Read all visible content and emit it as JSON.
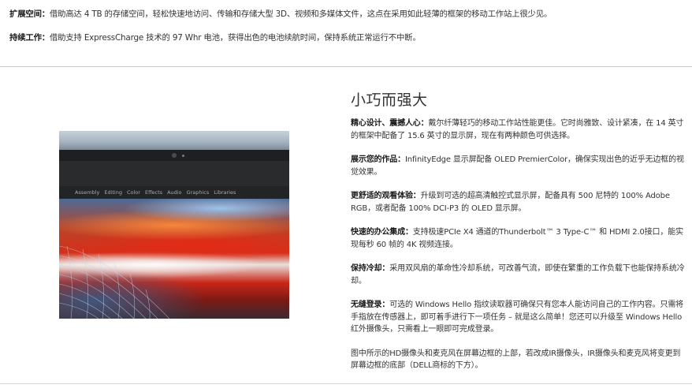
{
  "top": {
    "items": [
      {
        "label": "扩展空间：",
        "text": "借助高达 4 TB 的存储空间，轻松快速地访问、传输和存储大型 3D、视频和多媒体文件，这点在采用如此轻薄的框架的移动工作站上很少见。"
      },
      {
        "label": "持续工作：",
        "text": "借助支持 ExpressCharge 技术的 97 Whr 电池，获得出色的电池续航时间，保持系统正常运行不中断。"
      }
    ]
  },
  "image": {
    "menu_items": [
      "Assembly",
      "Editing",
      "Color",
      "Effects",
      "Audio",
      "Graphics",
      "Libraries"
    ]
  },
  "section": {
    "title": "小巧而强大",
    "items": [
      {
        "label": "精心设计、震撼人心：",
        "text": "戴尔纤薄轻巧的移动工作站性能更佳。它时尚雅致、设计紧凑，在 14 英寸的框架中配备了 15.6 英寸的显示屏，现在有两种颜色可供选择。"
      },
      {
        "label": "展示您的作品：",
        "text": "InfinityEdge 显示屏配备 OLED PremierColor，确保实现出色的近乎无边框的视觉效果。"
      },
      {
        "label": "更舒适的观看体验：",
        "text": "升级到可选的超高清触控式显示屏，配备具有 500 尼特的 100% Adobe RGB，或者配备 100% DCI-P3 的 OLED 显示屏。"
      },
      {
        "label": "快速的办公集成：",
        "text": "支持极速PCIe X4 通道的Thunderbolt™ 3 Type-C™ 和 HDMI 2.0接口，能实现每秒 60 帧的 4K 视频连接。"
      },
      {
        "label": "保持冷却：",
        "text": "采用双风扇的革命性冷却系统，可改善气流，即使在繁重的工作负载下也能保持系统冷却。"
      },
      {
        "label": "无缝登录：",
        "text": "可选的 Windows Hello 指纹读取器可确保只有您本人能访问自己的工作内容。只需将手指放在传感器上，即可着手进行下一项任务 – 就是这么简单！您还可以升级至 Windows Hello 红外摄像头，只需看上一眼即可完成登录。"
      },
      {
        "label": "",
        "text": "图中所示的HD摄像头和麦克风在屏幕边框的上部，若改成IR摄像头，IR摄像头和麦克风将变更到屏幕边框的底部（DELL商标的下方）。"
      }
    ]
  }
}
